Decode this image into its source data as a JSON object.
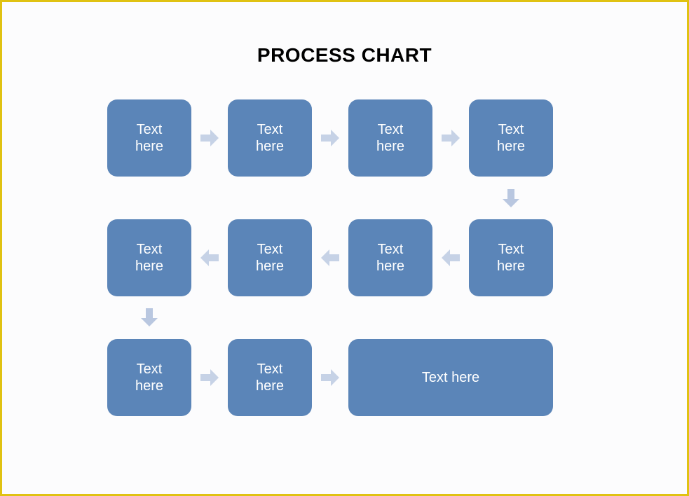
{
  "title": "PROCESS CHART",
  "placeholder": "Text\nhere",
  "placeholder_single": "Text here",
  "colors": {
    "box_fill": "#5b85b8",
    "arrow_fill": "#c6d2e6",
    "border": "#e0c212"
  },
  "rows": [
    {
      "direction": "right",
      "boxes": [
        {
          "label": "Text\nhere"
        },
        {
          "label": "Text\nhere"
        },
        {
          "label": "Text\nhere"
        },
        {
          "label": "Text\nhere"
        }
      ]
    },
    {
      "direction": "left",
      "boxes": [
        {
          "label": "Text\nhere"
        },
        {
          "label": "Text\nhere"
        },
        {
          "label": "Text\nhere"
        },
        {
          "label": "Text\nhere"
        }
      ]
    },
    {
      "direction": "right",
      "boxes": [
        {
          "label": "Text\nhere"
        },
        {
          "label": "Text\nhere"
        },
        {
          "label": "Text here",
          "wide": true
        }
      ]
    }
  ],
  "vertical_connectors": [
    {
      "from": "row1-box4",
      "to": "row2-box4",
      "direction": "down"
    },
    {
      "from": "row2-box1",
      "to": "row3-box1",
      "direction": "down"
    }
  ]
}
